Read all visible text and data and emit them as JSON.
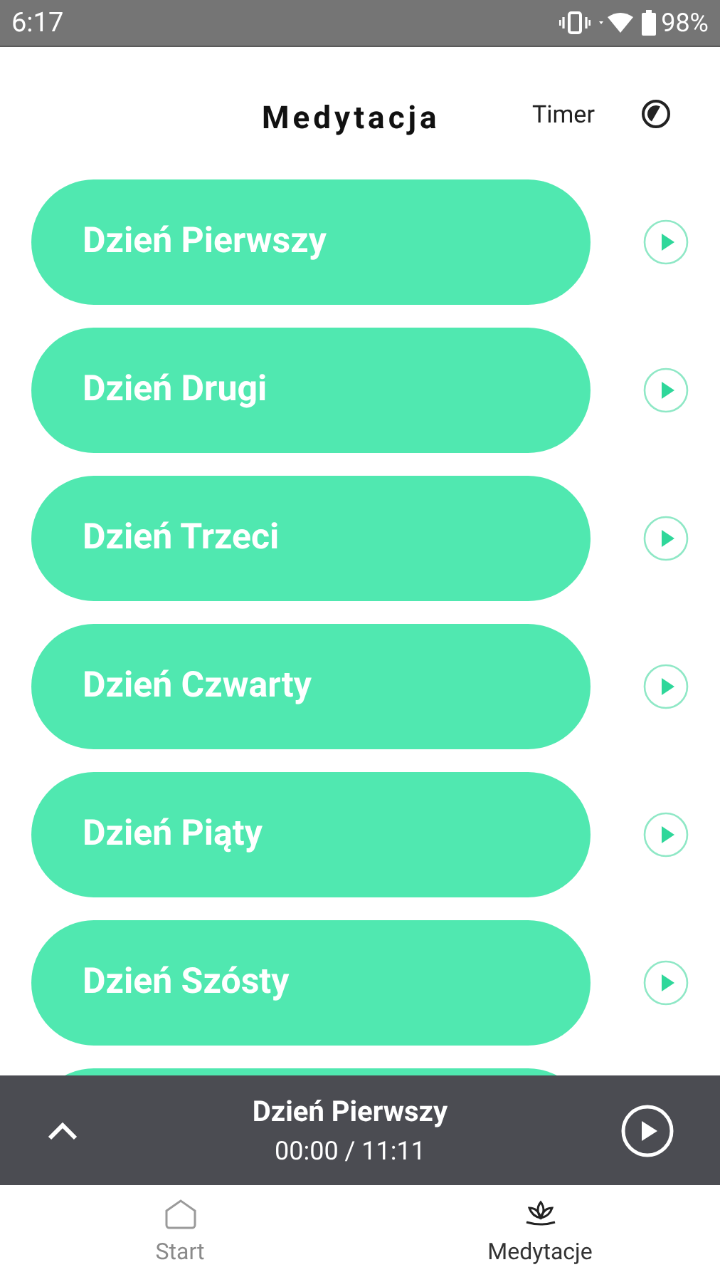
{
  "status_bar": {
    "time": "6:17",
    "battery": "98%"
  },
  "header": {
    "title": "Medytacja",
    "timer_label": "Timer"
  },
  "sessions": [
    {
      "title": "Dzień Pierwszy"
    },
    {
      "title": "Dzień Drugi"
    },
    {
      "title": "Dzień Trzeci"
    },
    {
      "title": "Dzień Czwarty"
    },
    {
      "title": "Dzień Piąty"
    },
    {
      "title": "Dzień Szósty"
    }
  ],
  "player": {
    "title": "Dzień Pierwszy",
    "time": "00:00 / 11:11"
  },
  "tabs": [
    {
      "label": "Start",
      "kind": "home",
      "selected": false
    },
    {
      "label": "Medytacje",
      "kind": "lotus",
      "selected": true
    }
  ]
}
